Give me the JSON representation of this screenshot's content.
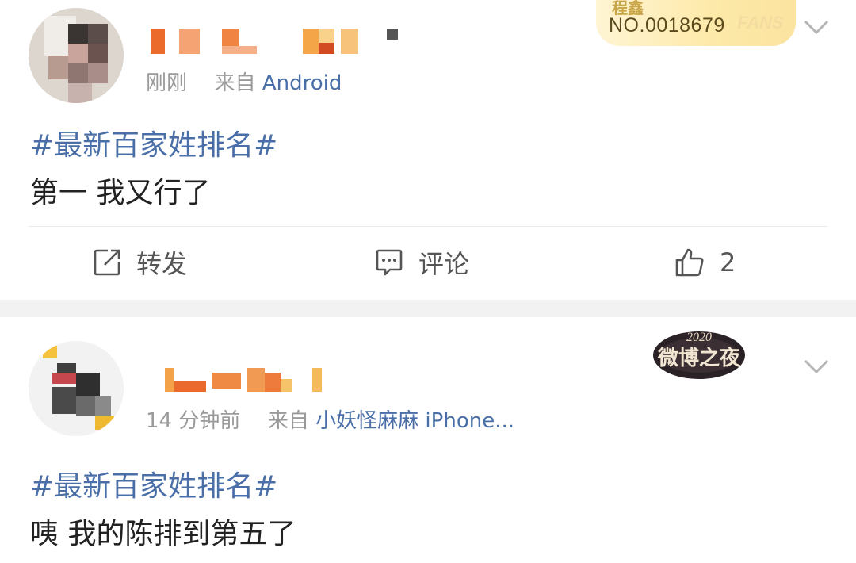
{
  "posts": [
    {
      "time": "刚刚",
      "source_prefix": "来自",
      "source": "Android",
      "badge": {
        "top_text": "程鑫",
        "number": "NO.0018679",
        "fans": "FANS"
      },
      "topic": "#最新百家姓排名#",
      "text": "第一 我又行了",
      "actions": {
        "repost": "转发",
        "comment": "评论",
        "like_count": "2"
      }
    },
    {
      "time": "14 分钟前",
      "source_prefix": "来自",
      "source": "小妖怪麻麻 iPhone...",
      "badge": {
        "year": "2020",
        "title": "微博之夜"
      },
      "topic": "#最新百家姓排名#",
      "text": "咦 我的陈排到第五了"
    }
  ],
  "colors": {
    "link": "#4a6fa8",
    "meta": "#9a9a9a",
    "text": "#222222",
    "separator": "#f2f2f2"
  },
  "icons": [
    "chevron-down-icon",
    "repost-icon",
    "comment-icon",
    "like-icon"
  ]
}
